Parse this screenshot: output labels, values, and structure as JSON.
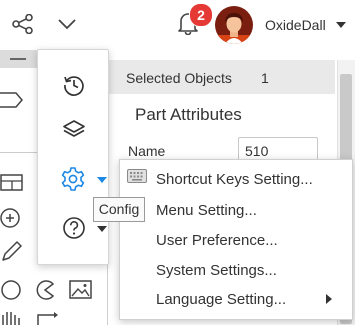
{
  "header": {
    "notification_count": "2",
    "username": "OxideDall"
  },
  "panel": {
    "header_title": "Selected Objects",
    "header_count": "1",
    "section_title": "Part Attributes",
    "name_label": "Name",
    "name_value": "510"
  },
  "tooltip": "Config",
  "settings_menu": {
    "items": [
      {
        "label": "Shortcut Keys Setting...",
        "icon": "keyboard-icon"
      },
      {
        "label": "Menu Setting..."
      },
      {
        "label": "User Preference..."
      },
      {
        "label": "System Settings..."
      },
      {
        "label": "Language Setting...",
        "submenu": true
      }
    ]
  },
  "colors": {
    "badge": "#e53935",
    "accent": "#1e88e5",
    "panel_header": "#e9e9e9"
  }
}
